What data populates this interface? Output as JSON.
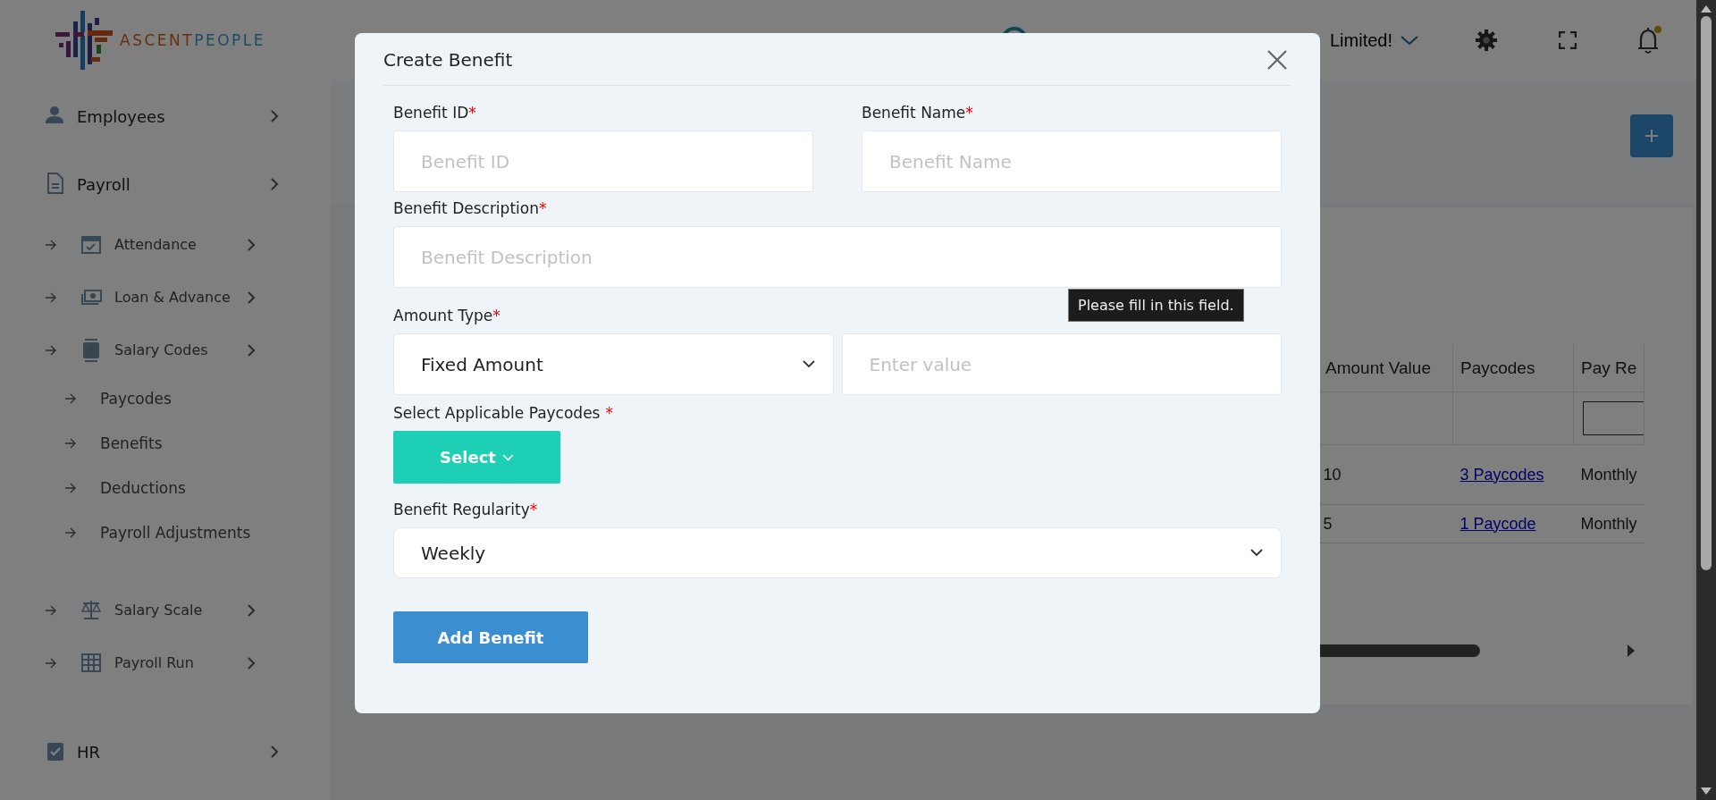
{
  "logo": {
    "parts": [
      "ASCENT",
      "PEOPLE"
    ]
  },
  "header": {
    "greeting": "Limited!"
  },
  "sidebar": {
    "items": [
      {
        "label": "Employees"
      },
      {
        "label": "Payroll",
        "children": [
          {
            "label": "Attendance"
          },
          {
            "label": "Loan & Advance"
          },
          {
            "label": "Salary Codes",
            "children": [
              {
                "label": "Paycodes"
              },
              {
                "label": "Benefits"
              },
              {
                "label": "Deductions"
              },
              {
                "label": "Payroll Adjustments"
              }
            ]
          },
          {
            "label": "Salary Scale"
          },
          {
            "label": "Payroll Run"
          }
        ]
      },
      {
        "label": "HR"
      }
    ]
  },
  "table": {
    "columns": [
      "Amount Value",
      "Paycodes",
      "Pay Re"
    ],
    "rows": [
      {
        "cells": [
          "10",
          "3 Paycodes",
          "Monthly"
        ]
      },
      {
        "cells": [
          "5",
          "1 Paycode",
          "Monthly"
        ]
      }
    ]
  },
  "modal": {
    "title": "Create Benefit",
    "required_mark": "*",
    "rows": [
      [
        {
          "kind": "input",
          "label": "Benefit ID",
          "required": true,
          "placeholder": "Benefit ID"
        },
        {
          "kind": "input",
          "label": "Benefit Name",
          "required": true,
          "placeholder": "Benefit Name"
        }
      ],
      [
        {
          "kind": "input",
          "label": "Benefit Description",
          "required": true,
          "placeholder": "Benefit Description"
        }
      ],
      [
        {
          "kind": "select",
          "label": "Amount Type",
          "required": true,
          "value": "Fixed Amount"
        },
        {
          "kind": "input",
          "placeholder": "Enter value"
        }
      ],
      [
        {
          "kind": "dropdown-button",
          "label": "Select Applicable Paycodes",
          "required": true,
          "text": "Select"
        }
      ],
      [
        {
          "kind": "select",
          "label": "Benefit Regularity",
          "required": true,
          "value": "Weekly"
        }
      ]
    ],
    "submit": "Add Benefit",
    "tooltip": "Please fill in this field."
  }
}
